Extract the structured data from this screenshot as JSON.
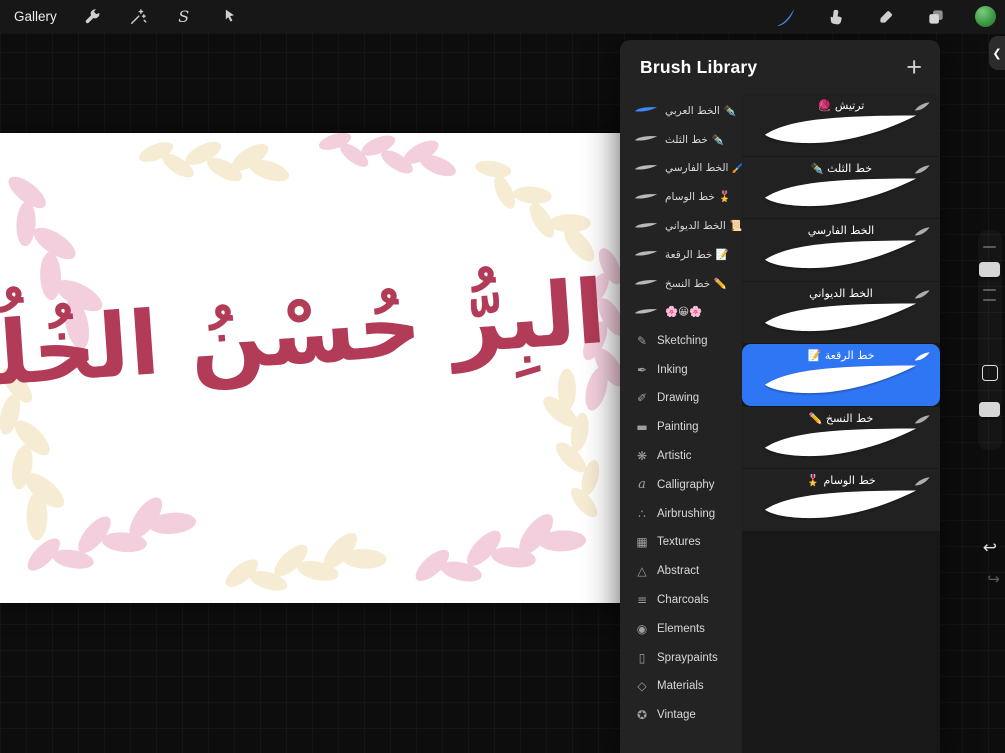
{
  "toolbar": {
    "gallery_label": "Gallery",
    "selection_glyph": "S"
  },
  "brush_library": {
    "title": "Brush Library",
    "add_label": "+",
    "categories": [
      {
        "label": "الخط العربي ✒️",
        "type": "brush-set"
      },
      {
        "label": "خط الثلث ✒️",
        "type": "brush-set"
      },
      {
        "label": "الخط الفارسي 🖌️",
        "type": "brush-set"
      },
      {
        "label": "خط الوسام 🎖️",
        "type": "brush-set"
      },
      {
        "label": "الخط الديواني 📜",
        "type": "brush-set"
      },
      {
        "label": "خط الرقعة 📝",
        "type": "brush-set"
      },
      {
        "label": "خط النسخ ✏️",
        "type": "brush-set"
      },
      {
        "label": "🌸😀🌸",
        "type": "brush-set"
      },
      {
        "label": "Sketching",
        "glyph": "✎"
      },
      {
        "label": "Inking",
        "glyph": "✒"
      },
      {
        "label": "Drawing",
        "glyph": "✐"
      },
      {
        "label": "Painting",
        "glyph": "▬"
      },
      {
        "label": "Artistic",
        "glyph": "❋"
      },
      {
        "label": "Calligraphy",
        "glyph": "a"
      },
      {
        "label": "Airbrushing",
        "glyph": "∴"
      },
      {
        "label": "Textures",
        "glyph": "▦"
      },
      {
        "label": "Abstract",
        "glyph": "△"
      },
      {
        "label": "Charcoals",
        "glyph": "≡"
      },
      {
        "label": "Elements",
        "glyph": "◉"
      },
      {
        "label": "Spraypaints",
        "glyph": "▯"
      },
      {
        "label": "Materials",
        "glyph": "◇"
      },
      {
        "label": "Vintage",
        "glyph": "✪"
      }
    ],
    "brushes": [
      {
        "name": "ترتيش 🧶",
        "selected": false
      },
      {
        "name": "خط الثلث ✒️",
        "selected": false
      },
      {
        "name": "الخط الفارسي",
        "selected": false
      },
      {
        "name": "الخط الديواني",
        "selected": false
      },
      {
        "name": "خط الرقعة 📝",
        "selected": true
      },
      {
        "name": "خط النسخ ✏️",
        "selected": false
      },
      {
        "name": "خط الوسام 🎖️",
        "selected": false
      }
    ]
  },
  "canvas": {
    "calligraphy_text": "البِرُّ حُسْنُ الخُلُقِ"
  },
  "side_controls": {
    "undo_glyph": "↩",
    "redo_glyph": "↪",
    "panel_handle_glyph": "❮"
  },
  "colors": {
    "selected_brush": "#2f76f5",
    "active_tool_blue": "#4a8df8",
    "calligraphy_red": "#b23b57",
    "leaf_pink": "#f2cadb",
    "leaf_cream": "#f6ebcf",
    "color_swatch_green": "#3f9b44",
    "panel_bg": "#232323"
  }
}
